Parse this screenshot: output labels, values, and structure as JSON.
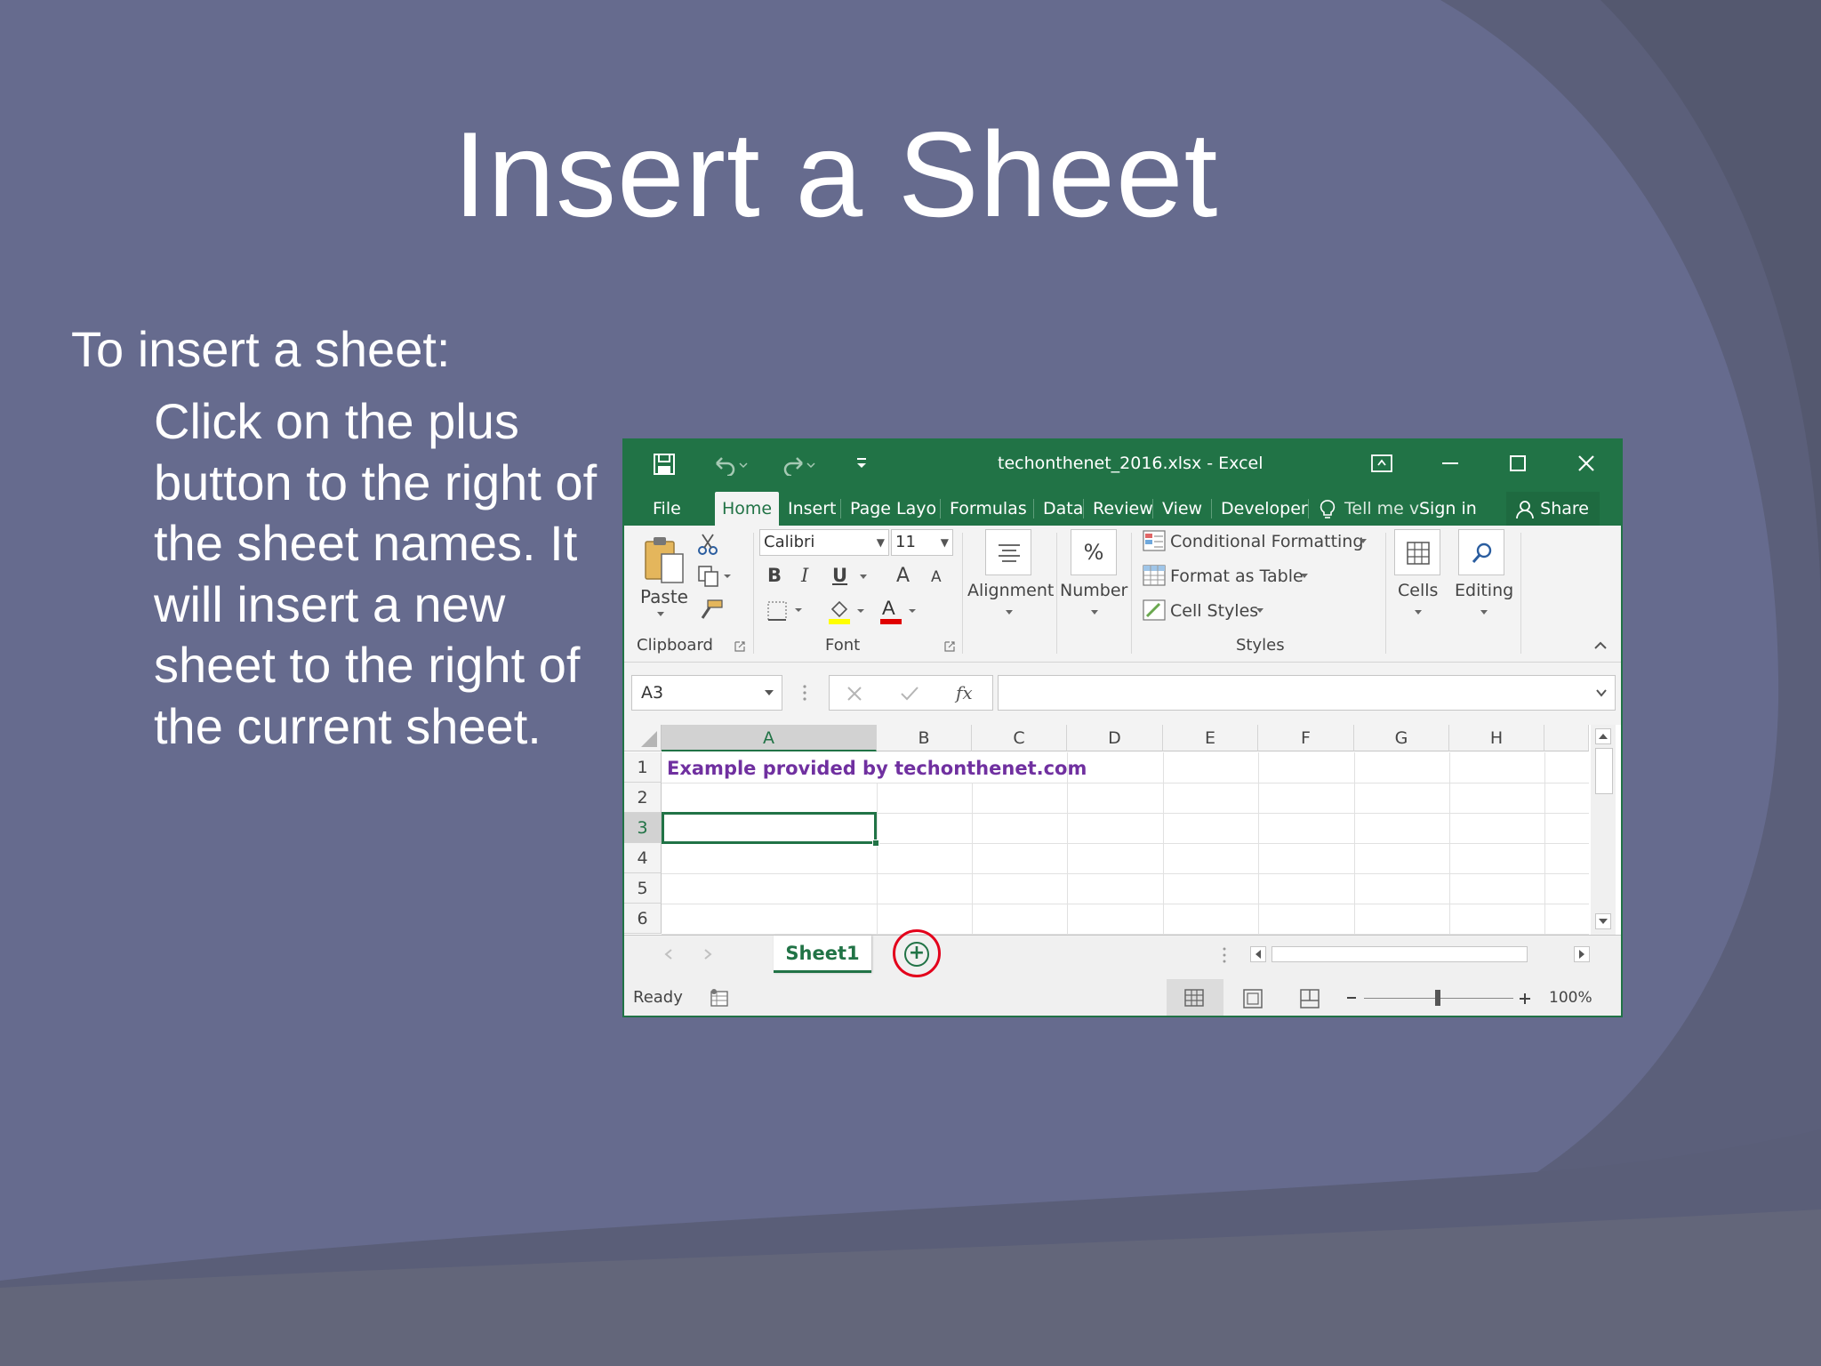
{
  "slide": {
    "title": "Insert a Sheet",
    "lead": "To insert a sheet:",
    "body": "Click on the plus button to the right of the sheet names. It will insert a new sheet to the right of the current sheet."
  },
  "excel": {
    "window_title": "techonthenet_2016.xlsx - Excel",
    "tabs": {
      "file": "File",
      "home": "Home",
      "insert": "Insert",
      "page_layout": "Page Layou",
      "formulas": "Formulas",
      "data": "Data",
      "review": "Review",
      "view": "View",
      "developer": "Developer",
      "tell_me": "Tell me v",
      "sign_in": "Sign in",
      "share": "Share"
    },
    "ribbon": {
      "paste": "Paste",
      "clipboard": "Clipboard",
      "font_name": "Calibri",
      "font_size": "11",
      "bold": "B",
      "italic": "I",
      "underline": "U",
      "grow_font": "A",
      "shrink_font": "A",
      "font_group": "Font",
      "alignment": "Alignment",
      "number": "Number",
      "percent": "%",
      "conditional_formatting": "Conditional Formatting",
      "format_as_table": "Format as Table",
      "cell_styles": "Cell Styles",
      "styles_group": "Styles",
      "cells": "Cells",
      "editing": "Editing"
    },
    "formula_bar": {
      "name_box": "A3",
      "formula": ""
    },
    "columns": [
      "A",
      "B",
      "C",
      "D",
      "E",
      "F",
      "G",
      "H"
    ],
    "rows": [
      "1",
      "2",
      "3",
      "4",
      "5",
      "6"
    ],
    "cell_a1": "Example provided by techonthenet.com",
    "selected_cell": "A3",
    "sheet_tab": "Sheet1",
    "status": {
      "ready": "Ready",
      "zoom": "100%"
    },
    "colors": {
      "excel_green": "#217346",
      "highlight_red": "#e3001b",
      "a1_text": "#7030a0"
    }
  }
}
